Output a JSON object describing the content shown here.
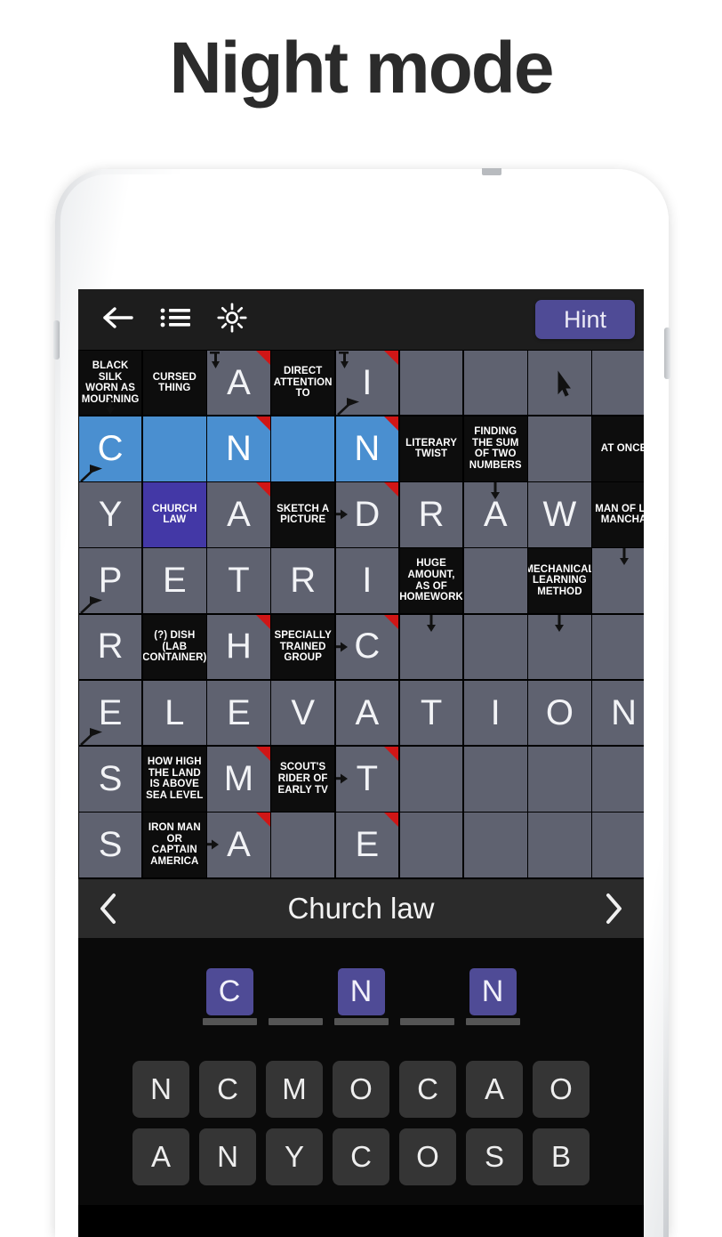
{
  "page": {
    "title": "Night mode"
  },
  "toolbar": {
    "back_icon": "back-arrow-icon",
    "list_icon": "list-icon",
    "brightness_icon": "brightness-sun-icon",
    "hint_label": "Hint",
    "hint_color": "#4f4b96"
  },
  "grid": {
    "columns": 9,
    "rows": 8,
    "cells": [
      [
        {
          "type": "clue",
          "text": "BLACK SILK WORN AS MOURNING",
          "marks": [
            "down-center-bottom"
          ]
        },
        {
          "type": "clue",
          "text": "CURSED THING"
        },
        {
          "type": "letter",
          "text": "A",
          "marks": [
            "red-corner",
            "down-left"
          ]
        },
        {
          "type": "clue",
          "text": "DIRECT ATTENTION TO"
        },
        {
          "type": "letter",
          "text": "I",
          "marks": [
            "red-corner",
            "down-left",
            "diag-right"
          ]
        },
        {
          "type": "empty",
          "text": ""
        },
        {
          "type": "empty",
          "text": ""
        },
        {
          "type": "empty",
          "text": "",
          "marks": [
            "cursor"
          ]
        },
        {
          "type": "empty",
          "text": ""
        }
      ],
      [
        {
          "type": "sel",
          "text": "C",
          "marks": [
            "diag-right"
          ]
        },
        {
          "type": "sel",
          "text": ""
        },
        {
          "type": "sel",
          "text": "N",
          "marks": [
            "red-corner"
          ]
        },
        {
          "type": "sel",
          "text": ""
        },
        {
          "type": "sel",
          "text": "N",
          "marks": [
            "red-corner"
          ]
        },
        {
          "type": "clue",
          "text": "LITERARY TWIST"
        },
        {
          "type": "clue",
          "text": "FINDING THE SUM OF TWO NUMBERS"
        },
        {
          "type": "empty",
          "text": ""
        },
        {
          "type": "clue",
          "text": "AT ONCE"
        }
      ],
      [
        {
          "type": "letter",
          "text": "Y"
        },
        {
          "type": "selclue",
          "text": "CHURCH LAW"
        },
        {
          "type": "letter",
          "text": "A",
          "marks": [
            "red-corner"
          ]
        },
        {
          "type": "clue",
          "text": "SKETCH A PICTURE"
        },
        {
          "type": "letter",
          "text": "D",
          "marks": [
            "red-corner",
            "right-arrow"
          ]
        },
        {
          "type": "letter",
          "text": "R"
        },
        {
          "type": "letter",
          "text": "A",
          "marks": [
            "down-center"
          ]
        },
        {
          "type": "letter",
          "text": "W"
        },
        {
          "type": "clue",
          "text": "MAN OF LA MANCHA"
        }
      ],
      [
        {
          "type": "letter",
          "text": "P",
          "marks": [
            "diag-right"
          ]
        },
        {
          "type": "letter",
          "text": "E"
        },
        {
          "type": "letter",
          "text": "T"
        },
        {
          "type": "letter",
          "text": "R"
        },
        {
          "type": "letter",
          "text": "I"
        },
        {
          "type": "clue",
          "text": "HUGE AMOUNT, AS OF HOMEWORK"
        },
        {
          "type": "empty",
          "text": ""
        },
        {
          "type": "clue",
          "text": "MECHANICAL LEARNING METHOD"
        },
        {
          "type": "empty",
          "text": "",
          "marks": [
            "down-center"
          ]
        }
      ],
      [
        {
          "type": "letter",
          "text": "R"
        },
        {
          "type": "clue",
          "text": "(?) DISH (LAB CONTAINER)"
        },
        {
          "type": "letter",
          "text": "H",
          "marks": [
            "red-corner"
          ]
        },
        {
          "type": "clue",
          "text": "SPECIALLY TRAINED GROUP"
        },
        {
          "type": "letter",
          "text": "C",
          "marks": [
            "red-corner",
            "right-arrow"
          ]
        },
        {
          "type": "empty",
          "text": "",
          "marks": [
            "down-center"
          ]
        },
        {
          "type": "empty",
          "text": ""
        },
        {
          "type": "empty",
          "text": "",
          "marks": [
            "down-center"
          ]
        },
        {
          "type": "empty",
          "text": ""
        }
      ],
      [
        {
          "type": "letter",
          "text": "E",
          "marks": [
            "diag-right"
          ]
        },
        {
          "type": "letter",
          "text": "L"
        },
        {
          "type": "letter",
          "text": "E"
        },
        {
          "type": "letter",
          "text": "V"
        },
        {
          "type": "letter",
          "text": "A"
        },
        {
          "type": "letter",
          "text": "T"
        },
        {
          "type": "letter",
          "text": "I"
        },
        {
          "type": "letter",
          "text": "O"
        },
        {
          "type": "letter",
          "text": "N"
        }
      ],
      [
        {
          "type": "letter",
          "text": "S"
        },
        {
          "type": "clue",
          "text": "HOW HIGH THE LAND IS ABOVE SEA LEVEL"
        },
        {
          "type": "letter",
          "text": "M",
          "marks": [
            "red-corner"
          ]
        },
        {
          "type": "clue",
          "text": "SCOUT'S RIDER OF EARLY TV"
        },
        {
          "type": "letter",
          "text": "T",
          "marks": [
            "red-corner",
            "right-arrow"
          ]
        },
        {
          "type": "empty",
          "text": ""
        },
        {
          "type": "empty",
          "text": ""
        },
        {
          "type": "empty",
          "text": ""
        },
        {
          "type": "empty",
          "text": ""
        }
      ],
      [
        {
          "type": "letter",
          "text": "S"
        },
        {
          "type": "clue",
          "text": "IRON MAN OR CAPTAIN AMERICA"
        },
        {
          "type": "letter",
          "text": "A",
          "marks": [
            "red-corner",
            "right-arrow"
          ]
        },
        {
          "type": "empty",
          "text": ""
        },
        {
          "type": "letter",
          "text": "E",
          "marks": [
            "red-corner"
          ]
        },
        {
          "type": "empty",
          "text": ""
        },
        {
          "type": "empty",
          "text": ""
        },
        {
          "type": "empty",
          "text": ""
        },
        {
          "type": "empty",
          "text": ""
        }
      ]
    ]
  },
  "clue_bar": {
    "prev_icon": "chevron-left-icon",
    "next_icon": "chevron-right-icon",
    "clue": "Church law"
  },
  "answer_tray": {
    "slots": [
      {
        "letter": "C",
        "filled": true
      },
      {
        "letter": "",
        "filled": false
      },
      {
        "letter": "N",
        "filled": true
      },
      {
        "letter": "",
        "filled": false
      },
      {
        "letter": "N",
        "filled": true
      }
    ],
    "tile_color": "#4f4b96"
  },
  "keyboard": {
    "rows": [
      [
        "N",
        "C",
        "M",
        "O",
        "C",
        "A",
        "O"
      ],
      [
        "A",
        "N",
        "Y",
        "C",
        "O",
        "S",
        "B"
      ]
    ]
  }
}
